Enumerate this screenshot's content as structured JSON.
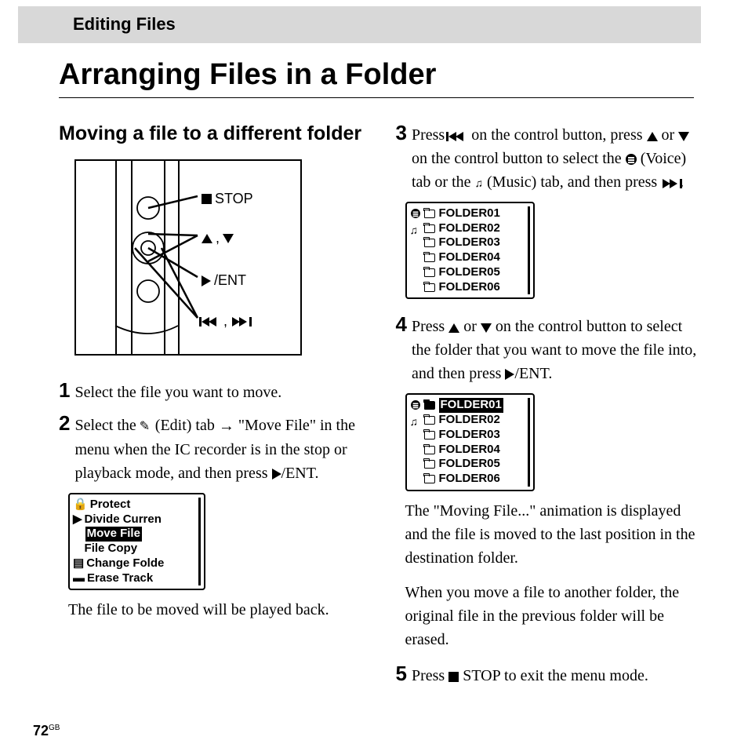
{
  "header": {
    "section": "Editing Files"
  },
  "title": "Arranging Files in a Folder",
  "moving": {
    "heading": "Moving a file to a different folder"
  },
  "diagram": {
    "stop": "STOP",
    "updown": ",",
    "ent": "/ENT",
    "rewff": ","
  },
  "steps": {
    "s1": "Select the file you want to move.",
    "s2a": "Select the ",
    "s2b": " (Edit) tab ",
    "s2c": " \"Move File\" in the menu when the IC recorder is in the stop or playback mode, and then press ",
    "s2d": "/ENT.",
    "s2_caption": "The file to be moved will be played back.",
    "s3a": "Press ",
    "s3b": " on the control button, press ",
    "s3c": " or ",
    "s3d": " on the control button to select the ",
    "s3e": " (Voice) tab or the ",
    "s3f": " (Music) tab, and then press ",
    "s3g": ".",
    "s4a": "Press ",
    "s4b": " or ",
    "s4c": " on the control button to select the folder that you want to move the file into, and then press ",
    "s4d": "/ENT.",
    "s4_p1": "The \"Moving File...\" animation is displayed and the file is moved to the last position in the destination folder.",
    "s4_p2": "When you move a file to another folder, the original file in the previous folder will be erased.",
    "s5a": "Press ",
    "s5b": " STOP to exit the menu mode."
  },
  "menu1": {
    "items": [
      "Protect",
      "Divide Curren",
      "Move File",
      "File Copy",
      "Change Folde",
      "Erase Track"
    ],
    "selected_index": 2
  },
  "folders": {
    "items": [
      "FOLDER01",
      "FOLDER02",
      "FOLDER03",
      "FOLDER04",
      "FOLDER05",
      "FOLDER06"
    ]
  },
  "footer": {
    "page": "72",
    "region": "GB"
  }
}
